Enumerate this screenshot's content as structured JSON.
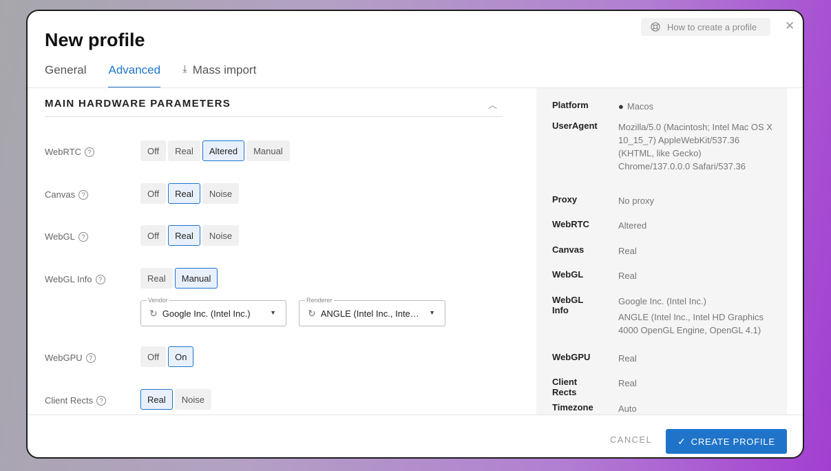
{
  "dialog": {
    "title": "New profile",
    "help_label": "How to create a profile",
    "close_glyph": "✕",
    "tabs": [
      {
        "label": "General",
        "active": false
      },
      {
        "label": "Advanced",
        "active": true
      },
      {
        "label": "Mass import",
        "active": false,
        "icon": "download-icon"
      }
    ]
  },
  "section": {
    "title": "MAIN HARDWARE PARAMETERS",
    "collapse_icon": "chevron-up-icon"
  },
  "params": [
    {
      "label": "WebRTC",
      "options": [
        "Off",
        "Real",
        "Altered",
        "Manual"
      ],
      "selected": "Altered"
    },
    {
      "label": "Canvas",
      "options": [
        "Off",
        "Real",
        "Noise"
      ],
      "selected": "Real"
    },
    {
      "label": "WebGL",
      "options": [
        "Off",
        "Real",
        "Noise"
      ],
      "selected": "Real"
    },
    {
      "label": "WebGL Info",
      "options": [
        "Real",
        "Manual"
      ],
      "selected": "Manual"
    },
    {
      "label": "WebGPU",
      "options": [
        "Off",
        "On"
      ],
      "selected": "On"
    },
    {
      "label": "Client Rects",
      "options": [
        "Real",
        "Noise"
      ],
      "selected": "Real"
    }
  ],
  "selects": {
    "vendor": {
      "legend": "Vendor",
      "value": "Google Inc. (Intel Inc.)"
    },
    "renderer": {
      "legend": "Renderer",
      "value": "ANGLE (Intel Inc., Inte…"
    }
  },
  "summary": {
    "platform": {
      "key": "Platform",
      "value": "Macos",
      "icon": "apple-icon"
    },
    "useragent": {
      "key": "UserAgent",
      "value": "Mozilla/5.0 (Macintosh; Intel Mac OS X 10_15_7) AppleWebKit/537.36 (KHTML, like Gecko) Chrome/137.0.0.0 Safari/537.36"
    },
    "proxy": {
      "key": "Proxy",
      "value": "No proxy"
    },
    "webrtc": {
      "key": "WebRTC",
      "value": "Altered"
    },
    "canvas": {
      "key": "Canvas",
      "value": "Real"
    },
    "webgl": {
      "key": "WebGL",
      "value": "Real"
    },
    "webglinfo": {
      "key": "WebGL Info",
      "vendor": "Google Inc. (Intel Inc.)",
      "renderer": "ANGLE (Intel Inc., Intel HD Graphics 4000 OpenGL Engine, OpenGL 4.1)"
    },
    "webgpu": {
      "key": "WebGPU",
      "value": "Real"
    },
    "clientrects": {
      "key": "Client Rects",
      "value": "Real"
    },
    "timezone": {
      "key": "Timezone",
      "value": "Auto"
    }
  },
  "footer": {
    "cancel_label": "CANCEL",
    "create_label": "CREATE PROFILE"
  },
  "colors": {
    "accent": "#1f74c9",
    "selected_bg": "#e8f1fb"
  }
}
